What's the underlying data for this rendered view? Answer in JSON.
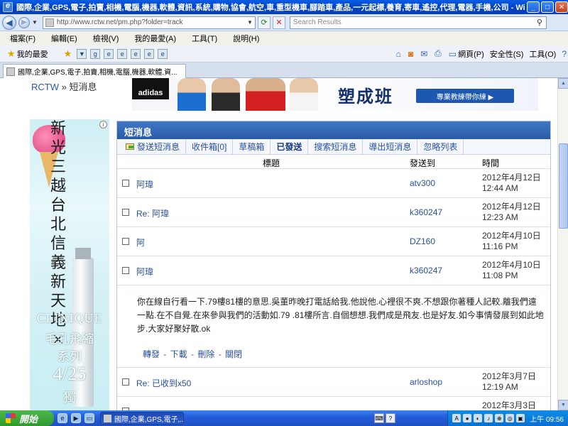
{
  "window": {
    "title": "國際,企業,GPS,電子,拍賣,相機,電腦,機器,軟體,資訊,系統,購物,協會,航空,車,重型機車,腳踏車,產品,一元起標,養育,寄車,遙控,代理,電器,手機,公司 - Windows Int...",
    "minimize": "_",
    "maximize": "□",
    "close": "✕"
  },
  "address": {
    "url": "http://www.rctw.net/pm.php?folder=track",
    "search_placeholder": "Search Results"
  },
  "menu": [
    "檔案(F)",
    "編輯(E)",
    "檢視(V)",
    "我的最愛(A)",
    "工具(T)",
    "說明(H)"
  ],
  "favorites": {
    "label": "我的最愛",
    "right_tools": [
      {
        "icon": "home-icon",
        "label": ""
      },
      {
        "icon": "feed-icon",
        "label": ""
      },
      {
        "icon": "mail-icon",
        "label": ""
      },
      {
        "icon": "print-icon",
        "label": ""
      },
      {
        "icon": "page-icon",
        "label": "網頁(P)"
      },
      {
        "icon": "safety-icon",
        "label": "安全性(S)"
      },
      {
        "icon": "tools-icon",
        "label": "工具(O)"
      },
      {
        "icon": "help-icon",
        "label": ""
      }
    ]
  },
  "tab": {
    "label": "國際,企業,GPS,電子,拍賣,相機,電腦,機器,軟體,資..."
  },
  "breadcrumb": {
    "home": "RCTW",
    "sep": "»",
    "current": "短消息"
  },
  "banner": {
    "brand": "adidas",
    "headline": "塑成班",
    "cta": "專業教練帶你練 ▶"
  },
  "side_ad": {
    "vertical_text": "新光三越台北信義新天地×",
    "brand": "CLINIQUE",
    "line1": "毛孔飛縮",
    "line2": "系列",
    "date": "4/25",
    "line4": "獨"
  },
  "pm": {
    "title": "短消息",
    "tabs": [
      {
        "label": "發送短消息",
        "active": false
      },
      {
        "label": "收件箱[0]",
        "active": false
      },
      {
        "label": "草稿箱",
        "active": false
      },
      {
        "label": "已發送",
        "active": true
      },
      {
        "label": "搜索短消息",
        "active": false
      },
      {
        "label": "導出短消息",
        "active": false
      },
      {
        "label": "忽略列表",
        "active": false
      }
    ],
    "columns": {
      "subject": "標題",
      "to": "發送到",
      "time": "時間"
    },
    "rows": [
      {
        "subject": "阿瑋",
        "to": "atv300",
        "date": "2012年4月12日",
        "time": "12:44 AM"
      },
      {
        "subject": "Re: 阿瑋",
        "to": "k360247",
        "date": "2012年4月12日",
        "time": "12:23 AM"
      },
      {
        "subject": "阿",
        "to": "DZ160",
        "date": "2012年4月10日",
        "time": "11:16 PM"
      },
      {
        "subject": "阿瑋",
        "to": "k360247",
        "date": "2012年4月10日",
        "time": "11:08 PM"
      }
    ],
    "expanded_body": "你在線自行看一下.79樓81樓的意思.吳董昨晚打電話給我.他說他.心裡很不爽.不想跟你著種人記較.離我們遠一點.在不自覺.在來參與我們的活動如.79 .81樓所言.自個想想.我們成是飛友.也是好友.如今事情發展到如此地步.大家好聚好散.ok",
    "actions": [
      "轉發",
      "下載",
      "刪除",
      "關閉"
    ],
    "rows_after": [
      {
        "subject": "Re: 已收到x50",
        "to": "arloshop",
        "date": "2012年3月7日",
        "time": "12:19 AM"
      },
      {
        "subject": "",
        "to": "",
        "date": "2012年3月3日",
        "time": ""
      }
    ]
  },
  "taskbar": {
    "start": "開始",
    "task": "國際,企業,GPS,電子,...",
    "clock": "上午 09:56"
  }
}
